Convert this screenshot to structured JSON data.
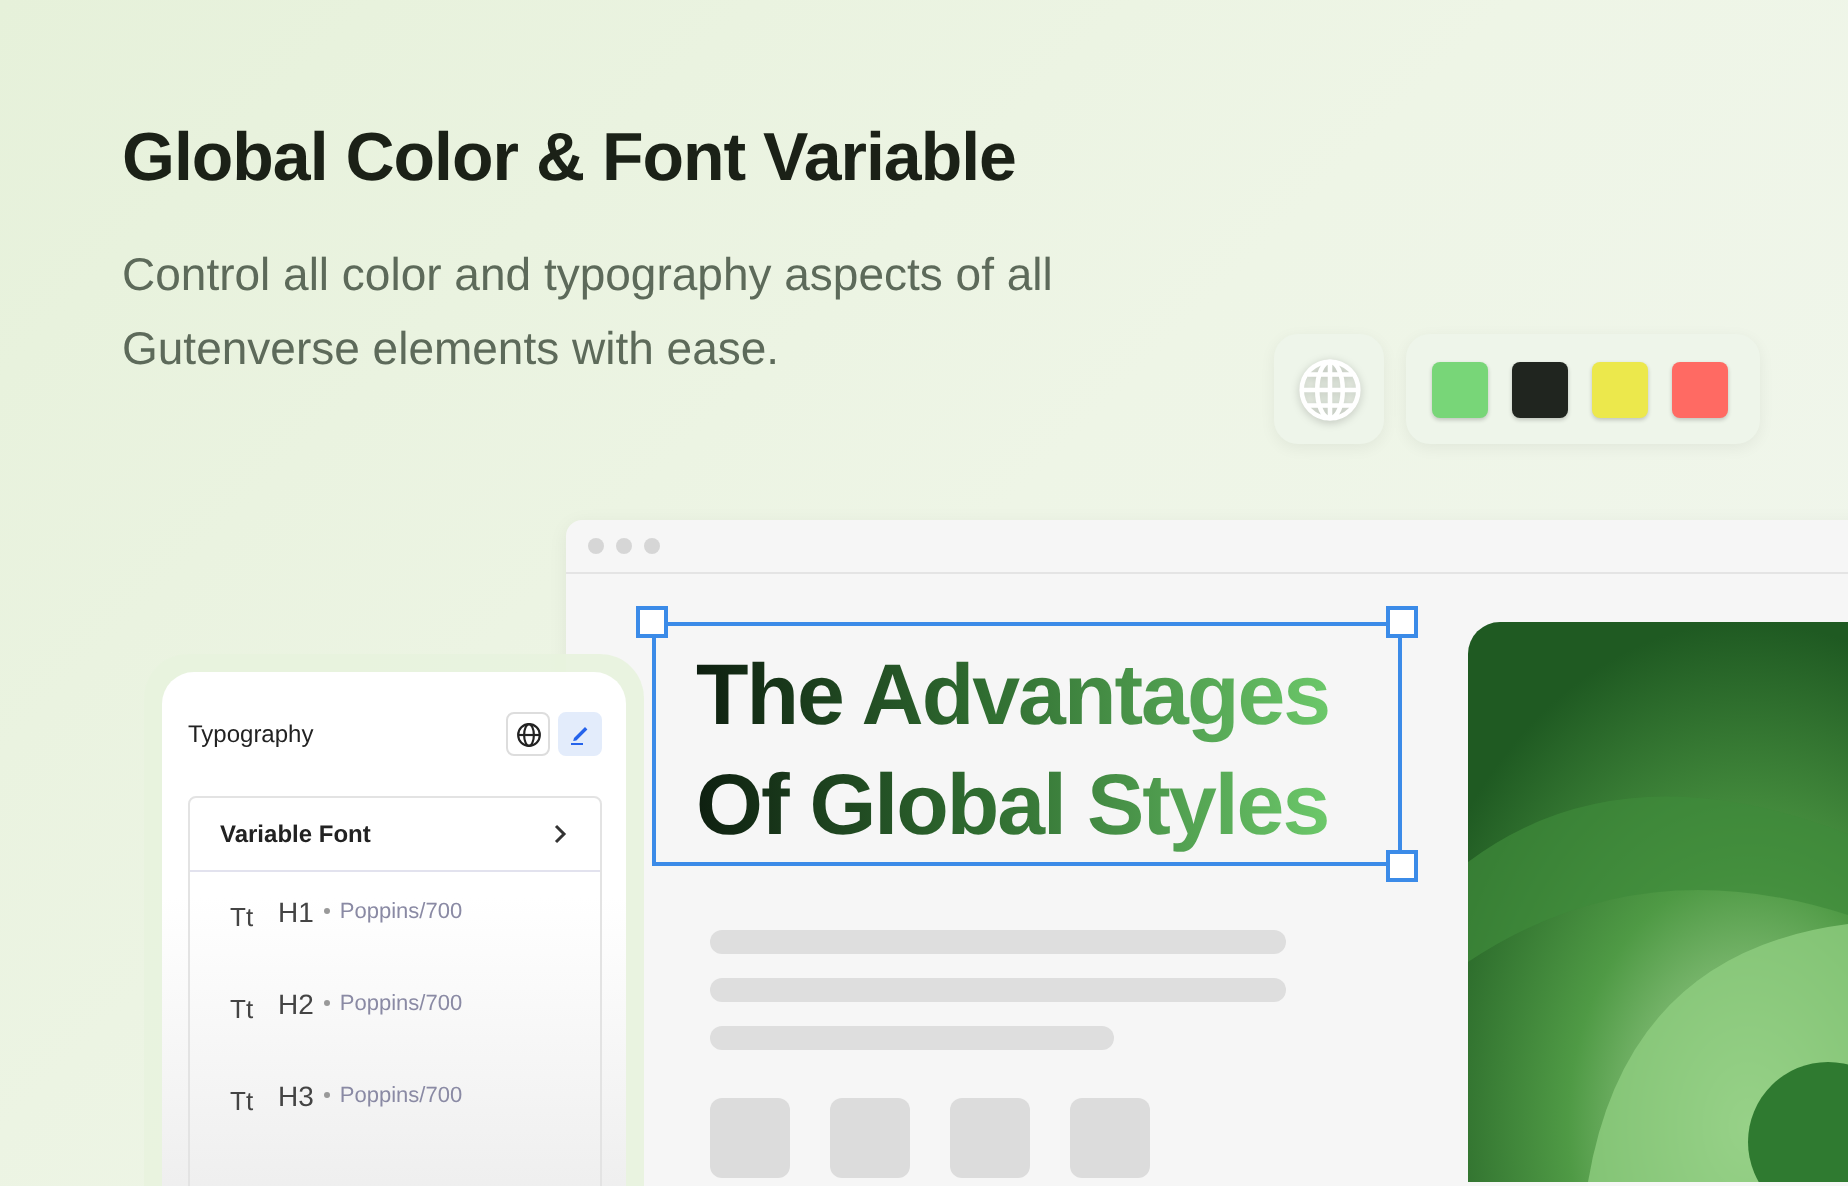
{
  "heading": "Global Color & Font Variable",
  "description": "Control all color and typography aspects of all Gutenverse elements with ease.",
  "palette": {
    "swatches": [
      {
        "color": "#78d678"
      },
      {
        "color": "#20251f"
      },
      {
        "color": "#ece84c"
      },
      {
        "color": "#ff6a63"
      }
    ]
  },
  "preview": {
    "headline_lines": [
      "The Advantages",
      "Of Global Styles"
    ]
  },
  "typography_panel": {
    "title": "Typography",
    "tabs": [
      {
        "kind": "globe",
        "selected": false
      },
      {
        "kind": "pen",
        "selected": true
      }
    ],
    "group": {
      "label": "Variable Font"
    },
    "items": [
      {
        "icon": "Tt",
        "tag": "H1",
        "font": "Poppins/700"
      },
      {
        "icon": "Tt",
        "tag": "H2",
        "font": "Poppins/700"
      },
      {
        "icon": "Tt",
        "tag": "H3",
        "font": "Poppins/700"
      }
    ]
  }
}
